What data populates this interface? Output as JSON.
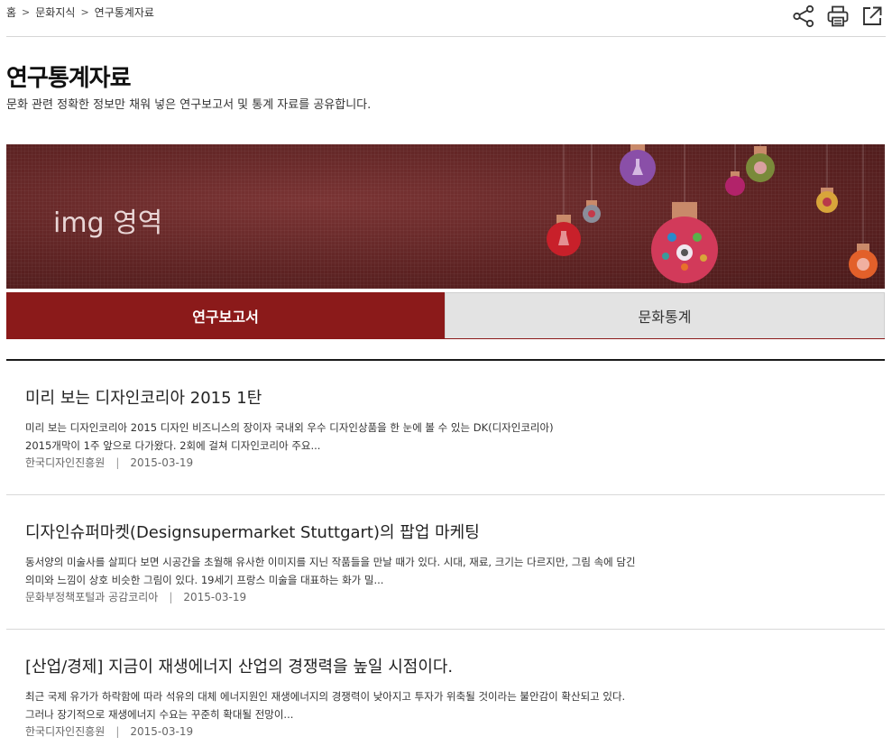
{
  "breadcrumb": {
    "home": "홈",
    "level1": "문화지식",
    "current": "연구통계자료"
  },
  "tools": {
    "share": "share-icon",
    "print": "print-icon",
    "popup": "external-link-icon"
  },
  "page": {
    "title": "연구통계자료",
    "description": "문화 관련 정확한 정보만 채워 넣은 연구보고서 및 통계 자료를 공유합니다."
  },
  "banner": {
    "text": "img 영역"
  },
  "tabs": [
    {
      "label": "연구보고서",
      "active": true
    },
    {
      "label": "문화통계",
      "active": false
    }
  ],
  "items": [
    {
      "title": "미리 보는 디자인코리아 2015 1탄",
      "summary_line1": "미리 보는 디자인코리아 2015 디자인 비즈니스의 장이자 국내외 우수 디자인상품을 한 눈에 볼 수 있는 DK(디자인코리아)",
      "summary_line2": "2015개막이 1주 앞으로 다가왔다. 2회에 걸쳐 디자인코리아 주요...",
      "source": "한국디자인진흥원",
      "date": "2015-03-19"
    },
    {
      "title": "디자인슈퍼마켓(Designsupermarket Stuttgart)의 팝업 마케팅",
      "summary_line1": "동서양의 미술사를 살피다 보면 시공간을 초월해 유사한 이미지를 지닌 작품들을 만날 때가 있다. 시대, 재료, 크기는 다르지만, 그림 속에 담긴",
      "summary_line2": "의미와 느낌이 상호 비슷한 그림이 있다. 19세기 프랑스 미술을 대표하는 화가 밀...",
      "source": "문화부정책포털과 공감코리아",
      "date": "2015-03-19"
    },
    {
      "title": "[산업/경제] 지금이 재생에너지 산업의 경쟁력을 높일 시점이다.",
      "summary_line1": "최근 국제 유가가 하락함에 따라 석유의 대체 에너지원인 재생에너지의 경쟁력이 낮아지고 투자가 위축될 것이라는 불안감이 확산되고 있다.",
      "summary_line2": "그러나 장기적으로 재생에너지 수요는 꾸준히 확대될 전망이...",
      "source": "한국디자인진흥원",
      "date": "2015-03-19"
    }
  ],
  "colors": {
    "accent": "#8b1a1a",
    "banner_bg": "#5e2323",
    "tab_inactive": "#e3e3e3"
  }
}
